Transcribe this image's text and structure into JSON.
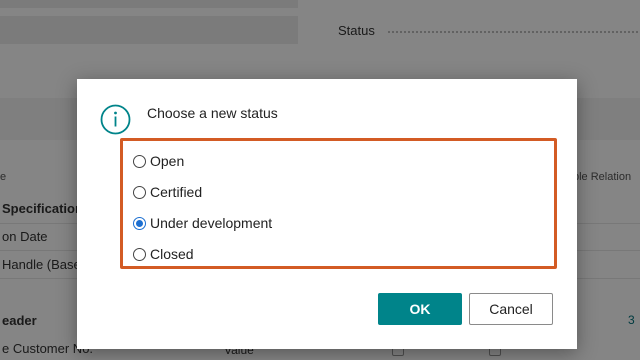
{
  "background": {
    "status_label": "Status",
    "col_left_header": "e",
    "col_right_header": "ble Relation",
    "rows": [
      {
        "text": "Specification",
        "bold": true
      },
      {
        "text": "on Date",
        "bold": false
      },
      {
        "text": "Handle (Base",
        "bold": false
      },
      {
        "text": "eader",
        "bold": true
      },
      {
        "text": "e Customer No.",
        "bold": false
      }
    ],
    "right_number": "3",
    "value_text": "Value"
  },
  "dialog": {
    "icon": "info-icon",
    "title": "Choose a new status",
    "options": [
      {
        "label": "Open",
        "selected": false
      },
      {
        "label": "Certified",
        "selected": false
      },
      {
        "label": "Under development",
        "selected": true
      },
      {
        "label": "Closed",
        "selected": false
      }
    ],
    "ok_label": "OK",
    "cancel_label": "Cancel"
  },
  "colors": {
    "accent": "#00848a",
    "highlight_border": "#d35b24",
    "radio_selected": "#1c6fd1"
  }
}
